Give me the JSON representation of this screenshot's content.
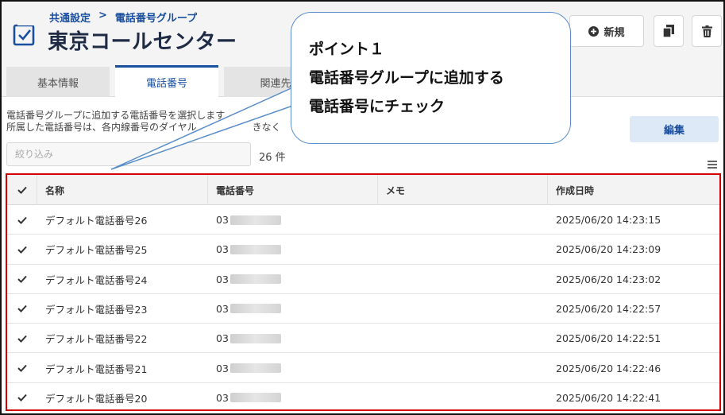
{
  "header": {
    "breadcrumb": [
      "共通設定",
      "電話番号グループ"
    ],
    "breadcrumb_separator": ">",
    "title": "東京コールセンター",
    "new_button_label": "新規",
    "icons": {
      "logo": "checkbox-square-icon",
      "new": "plus-circle-icon",
      "copy": "copy-icon",
      "delete": "trash-icon"
    }
  },
  "tabs": [
    {
      "label": "基本情報",
      "active": false
    },
    {
      "label": "電話番号",
      "active": true
    },
    {
      "label": "関連先",
      "active": false
    }
  ],
  "content": {
    "description_line1": "電話番号グループに追加する電話番号を選択します",
    "description_line2": "所属した電話番号は、各内線番号のダイヤル",
    "description_line2_tail": "きなく",
    "filter_placeholder": "絞り込み",
    "count_label": "26 件",
    "edit_button_label": "編集"
  },
  "table": {
    "columns": [
      "名称",
      "電話番号",
      "メモ",
      "作成日時"
    ],
    "rows": [
      {
        "name": "デフォルト電話番号26",
        "phone": "03",
        "memo": "",
        "created": "2025/06/20 14:23:15",
        "checked": true
      },
      {
        "name": "デフォルト電話番号25",
        "phone": "03",
        "memo": "",
        "created": "2025/06/20 14:23:09",
        "checked": true
      },
      {
        "name": "デフォルト電話番号24",
        "phone": "03",
        "memo": "",
        "created": "2025/06/20 14:23:02",
        "checked": true
      },
      {
        "name": "デフォルト電話番号23",
        "phone": "03",
        "memo": "",
        "created": "2025/06/20 14:22:57",
        "checked": true
      },
      {
        "name": "デフォルト電話番号22",
        "phone": "03",
        "memo": "",
        "created": "2025/06/20 14:22:51",
        "checked": true
      },
      {
        "name": "デフォルト電話番号21",
        "phone": "03",
        "memo": "",
        "created": "2025/06/20 14:22:46",
        "checked": true
      },
      {
        "name": "デフォルト電話番号20",
        "phone": "03",
        "memo": "",
        "created": "2025/06/20 14:22:41",
        "checked": true
      }
    ]
  },
  "callout": {
    "lines": [
      "ポイント１",
      "電話番号グループに追加する",
      "電話番号にチェック"
    ]
  },
  "colors": {
    "accent": "#1a4fa0",
    "highlight": "#d40000",
    "callout_border": "#5b8ec9"
  }
}
